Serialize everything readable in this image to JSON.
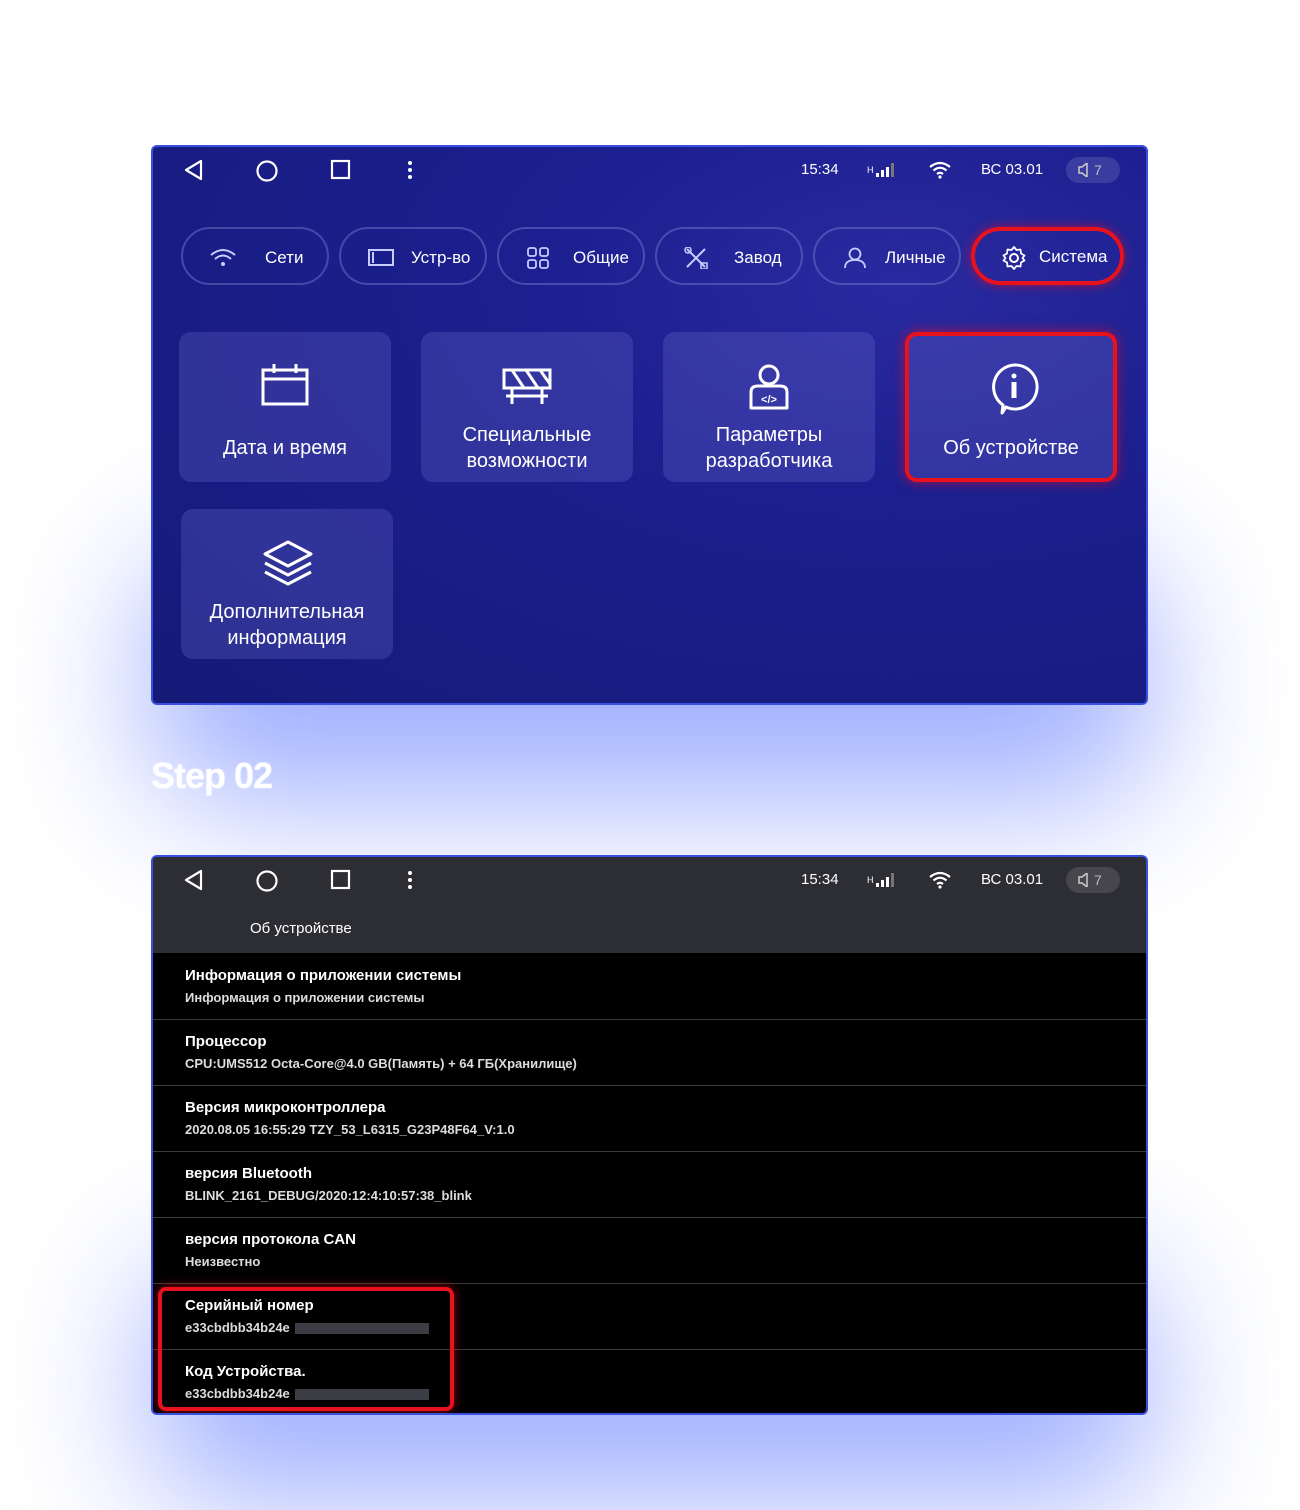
{
  "screen1": {
    "status": {
      "time": "15:34",
      "signal": "H",
      "date": "ВС 03.01",
      "volume": "7"
    },
    "tabs": [
      {
        "label": "Сети",
        "icon": "wifi-icon"
      },
      {
        "label": "Устр-во",
        "icon": "device-icon"
      },
      {
        "label": "Общие",
        "icon": "grid-icon"
      },
      {
        "label": "Завод",
        "icon": "tools-icon"
      },
      {
        "label": "Личные",
        "icon": "user-icon"
      },
      {
        "label": "Система",
        "icon": "gear-icon",
        "active": true
      }
    ],
    "tiles": [
      {
        "line1": "Дата и время",
        "line2": "",
        "icon": "calendar-icon"
      },
      {
        "line1": "Специальные",
        "line2": "возможности",
        "icon": "barrier-icon"
      },
      {
        "line1": "Параметры",
        "line2": "разработчика",
        "icon": "developer-icon"
      },
      {
        "line1": "Об устройстве",
        "line2": "",
        "icon": "info-icon",
        "active": true
      },
      {
        "line1": "Дополнительная",
        "line2": "информация",
        "icon": "layers-icon"
      }
    ]
  },
  "step_label": "Step 02",
  "screen2": {
    "status": {
      "time": "15:34",
      "signal": "H",
      "date": "ВС 03.01",
      "volume": "7"
    },
    "title": "Об устройстве",
    "rows": [
      {
        "title": "Информация о приложении системы",
        "value": "Информация о приложении системы"
      },
      {
        "title": "Процессор",
        "value": "CPU:UMS512 Octa-Core@4.0 GB(Память) + 64 ГБ(Хранилище)"
      },
      {
        "title": "Версия микроконтроллера",
        "value": "2020.08.05 16:55:29 TZY_53_L6315_G23P48F64_V:1.0"
      },
      {
        "title": "версия Bluetooth",
        "value": "BLINK_2161_DEBUG/2020:12:4:10:57:38_blink"
      },
      {
        "title": "версия протокола CAN",
        "value": "Неизвестно"
      },
      {
        "title": "Серийный номер",
        "value": "e33cbdbb34b24e"
      },
      {
        "title": "Код Устройства.",
        "value": "e33cbdbb34b24e"
      }
    ]
  }
}
